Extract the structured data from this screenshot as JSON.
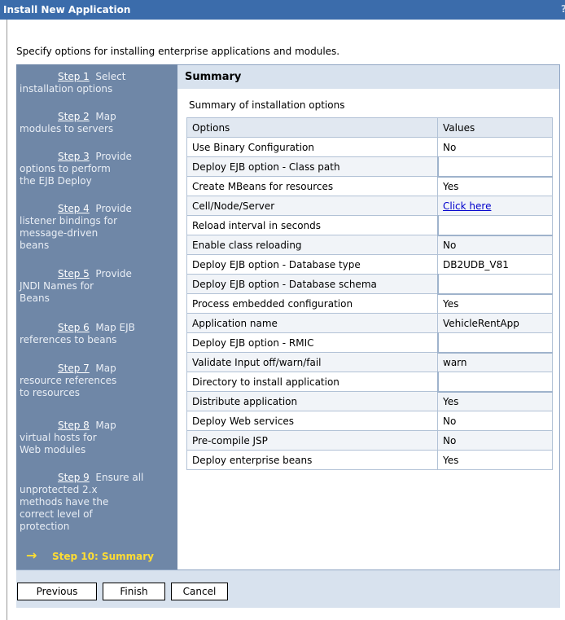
{
  "window": {
    "title": "Install New Application",
    "help": "?"
  },
  "intro": "Specify options for installing enterprise applications and modules.",
  "steps": [
    {
      "num": "Step 1",
      "l1": "Select",
      "rest": [
        "installation options"
      ]
    },
    {
      "num": "Step 2",
      "l1": "Map",
      "rest": [
        "modules to servers"
      ]
    },
    {
      "num": "Step 3",
      "l1": "Provide",
      "rest": [
        "options to perform",
        "the EJB Deploy"
      ]
    },
    {
      "num": "Step 4",
      "l1": "Provide",
      "rest": [
        "listener bindings for",
        "message-driven",
        "beans"
      ]
    },
    {
      "num": "Step 5",
      "l1": "Provide",
      "rest": [
        "JNDI Names for",
        "Beans"
      ]
    },
    {
      "num": "Step 6",
      "l1": "Map EJB",
      "rest": [
        "references to beans"
      ]
    },
    {
      "num": "Step 7",
      "l1": "Map",
      "rest": [
        "resource references",
        "to resources"
      ]
    },
    {
      "num": "Step 8",
      "l1": "Map",
      "rest": [
        "virtual hosts for",
        "Web modules"
      ]
    },
    {
      "num": "Step 9",
      "l1": "Ensure all",
      "rest": [
        "unprotected 2.x",
        "methods have the",
        "correct level of",
        "protection"
      ]
    }
  ],
  "current_step": {
    "arrow": "→",
    "label": "Step 10: Summary"
  },
  "summary": {
    "heading": "Summary",
    "caption": "Summary of installation options",
    "columns": [
      "Options",
      "Values"
    ],
    "rows": [
      {
        "option": "Use Binary Configuration",
        "value": "No"
      },
      {
        "option": "Deploy EJB option - Class path",
        "value": ""
      },
      {
        "option": "Create MBeans for resources",
        "value": "Yes"
      },
      {
        "option": "Cell/Node/Server",
        "value": "Click here",
        "link": true
      },
      {
        "option": "Reload interval in seconds",
        "value": ""
      },
      {
        "option": "Enable class reloading",
        "value": "No"
      },
      {
        "option": "Deploy EJB option - Database type",
        "value": "DB2UDB_V81"
      },
      {
        "option": "Deploy EJB option - Database schema",
        "value": ""
      },
      {
        "option": "Process embedded configuration",
        "value": "Yes"
      },
      {
        "option": "Application name",
        "value": "VehicleRentApp"
      },
      {
        "option": "Deploy EJB option - RMIC",
        "value": ""
      },
      {
        "option": "Validate Input off/warn/fail",
        "value": "warn"
      },
      {
        "option": "Directory to install application",
        "value": ""
      },
      {
        "option": "Distribute application",
        "value": "Yes"
      },
      {
        "option": "Deploy Web services",
        "value": "No"
      },
      {
        "option": "Pre-compile JSP",
        "value": "No"
      },
      {
        "option": "Deploy enterprise beans",
        "value": "Yes"
      }
    ]
  },
  "buttons": {
    "previous": "Previous",
    "finish": "Finish",
    "cancel": "Cancel"
  }
}
